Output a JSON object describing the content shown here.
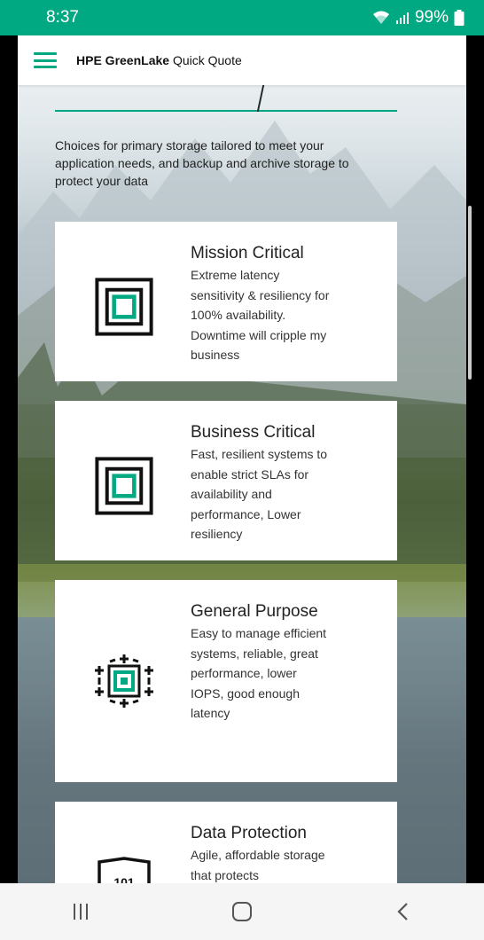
{
  "status_bar": {
    "time": "8:37",
    "battery": "99%",
    "wifi_icon": "wifi-icon",
    "signal_icon": "signal-icon",
    "battery_icon": "battery-icon"
  },
  "header": {
    "brand_bold": "HPE GreenLake",
    "brand_rest": " Quick Quote",
    "menu_icon": "hamburger-menu-icon"
  },
  "intro": {
    "text": "Choices for primary storage tailored to meet your application needs, and backup and archive storage to protect your data"
  },
  "cards": [
    {
      "title": "Mission Critical",
      "description": "Extreme latency sensitivity & resiliency for 100% availability. Downtime will cripple my business",
      "icon": "nested-square-icon"
    },
    {
      "title": "Business Critical",
      "description": "Fast, resilient systems to enable strict SLAs for availability and performance, Lower resiliency",
      "icon": "nested-square-icon"
    },
    {
      "title": "General Purpose",
      "description": "Easy to manage efficient systems, reliable, great performance, lower IOPS, good enough latency",
      "icon": "expandable-square-icon"
    },
    {
      "title": "Data Protection",
      "description": "Agile, affordable storage that protects",
      "icon": "shield-binary-icon",
      "icon_label": "101"
    }
  ],
  "nav_bar": {
    "recents_icon": "recents-icon",
    "home_icon": "home-icon",
    "back_icon": "back-icon"
  },
  "colors": {
    "accent": "#01a982",
    "status_bar": "#01a982",
    "card_bg": "#ffffff",
    "nav_bg": "#f5f5f5"
  }
}
